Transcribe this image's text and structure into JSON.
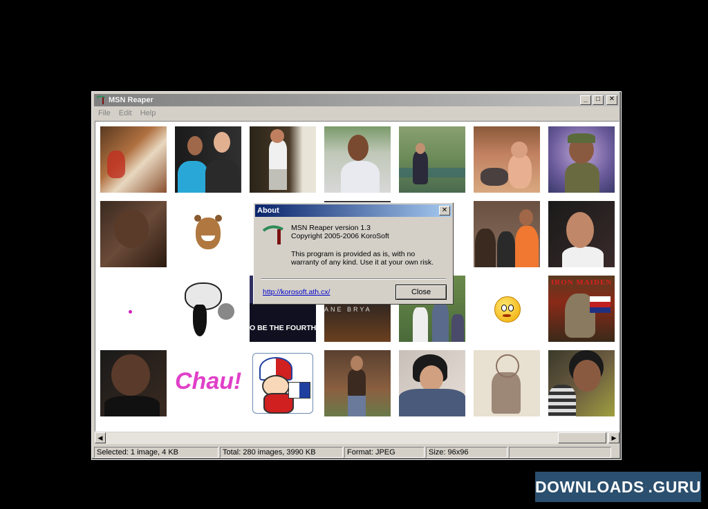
{
  "window": {
    "title": "MSN Reaper",
    "buttons": {
      "minimize": "_",
      "maximize": "□",
      "close": "✕"
    }
  },
  "menu": [
    "File",
    "Edit",
    "Help"
  ],
  "status": {
    "selected": "Selected: 1 image, 4 KB",
    "total": "Total: 280 images, 3990 KB",
    "format": "Format: JPEG",
    "size": "Size: 96x96",
    "extra": ""
  },
  "thumbnails_special": {
    "chau": "Chau!",
    "iron_maiden": "IRON MAIDEN",
    "be_the_fourth": "O BE THE FOURTH",
    "bryant": "ANE BRYA"
  },
  "about": {
    "title": "About",
    "line1": "MSN Reaper version 1.3",
    "line2": "Copyright 2005-2006 KoroSoft",
    "line3": "This program is provided as is, with no",
    "line4": "warranty of any kind. Use it at your own risk.",
    "link": "http://korosoft.ath.cx/",
    "close_label": "Close"
  },
  "badge": {
    "text": "DOWNLOADS",
    "suffix": ".GURU"
  },
  "colors": {
    "accent": "#0a246a",
    "badge": "#2b4f6e",
    "chau": "#e040c8"
  }
}
